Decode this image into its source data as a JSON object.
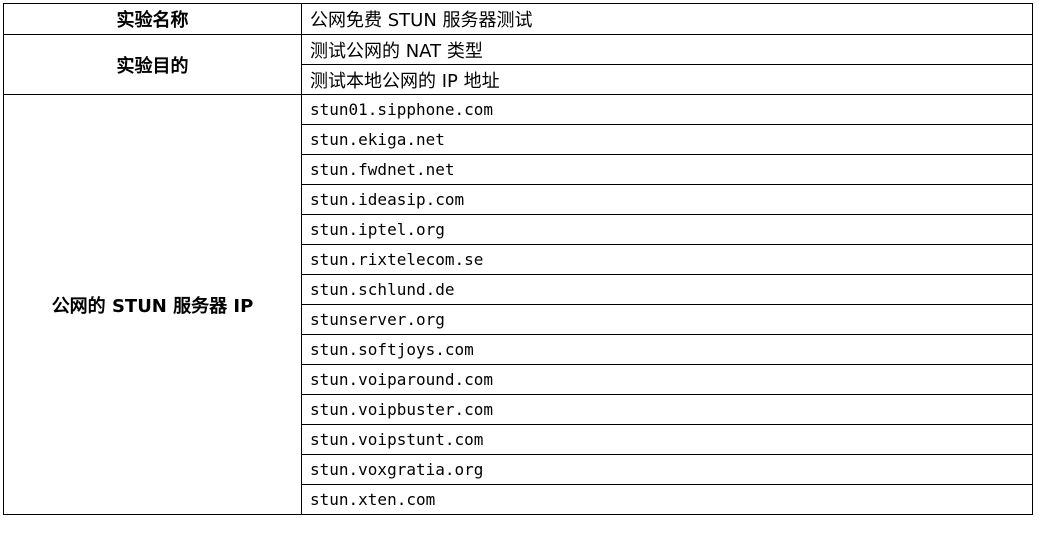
{
  "rows": {
    "name": {
      "label": "实验名称",
      "value": "公网免费 STUN 服务器测试"
    },
    "purpose": {
      "label": "实验目的",
      "items": [
        "测试公网的 NAT 类型",
        "测试本地公网的 IP 地址"
      ]
    },
    "servers": {
      "label": "公网的 STUN 服务器 IP",
      "items": [
        "stun01.sipphone.com",
        "stun.ekiga.net",
        "stun.fwdnet.net",
        "stun.ideasip.com",
        "stun.iptel.org",
        "stun.rixtelecom.se",
        "stun.schlund.de",
        "stunserver.org",
        "stun.softjoys.com",
        "stun.voiparound.com",
        "stun.voipbuster.com",
        "stun.voipstunt.com",
        "stun.voxgratia.org",
        "stun.xten.com"
      ]
    }
  }
}
